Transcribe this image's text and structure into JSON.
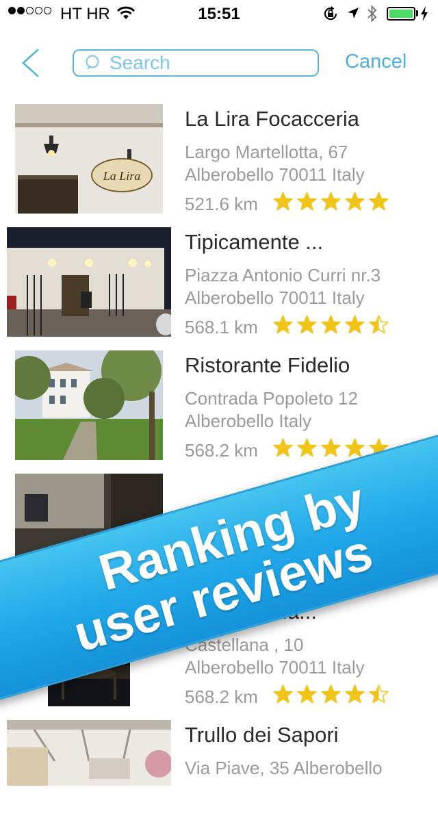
{
  "status_bar": {
    "carrier": "HT HR",
    "time": "15:51",
    "signal_bars_filled": 2,
    "signal_bars_total": 5,
    "battery_level": 1.0,
    "icons": [
      "wifi-icon",
      "rotation-lock-icon",
      "location-arrow-icon",
      "bluetooth-icon",
      "battery-icon",
      "charging-bolt-icon"
    ]
  },
  "nav": {
    "search_placeholder": "Search",
    "cancel_label": "Cancel"
  },
  "restaurants": [
    {
      "name": "La Lira Focacceria",
      "address_line1": "Largo Martellotta, 67",
      "address_line2": "Alberobello 70011 Italy",
      "distance": "521.6 km",
      "rating": 5
    },
    {
      "name": "Tipicamente ...",
      "address_line1": "Piazza Antonio Curri nr.3",
      "address_line2": "Alberobello 70011 Italy",
      "distance": "568.1 km",
      "rating": 4.5
    },
    {
      "name": "Ristorante Fidelio",
      "address_line1": "Contrada Popoleto 12",
      "address_line2": "Alberobello  Italy",
      "distance": "568.2 km",
      "rating": 5
    },
    {
      "name": "",
      "address_line1": "",
      "address_line2": "",
      "distance": "",
      "rating": 5
    },
    {
      "name": "...a Braceria...",
      "address_line1": "Castellana , 10",
      "address_line2": "Alberobello 70011 Italy",
      "distance": "568.2 km",
      "rating": 4.5
    },
    {
      "name": "Trullo dei Sapori",
      "address_line1": "Via Piave, 35 Alberobello",
      "address_line2": "",
      "distance": "",
      "rating": 0
    }
  ],
  "banner": {
    "line1": "Ranking by",
    "line2": "user reviews"
  },
  "colors": {
    "accent": "#4ab0db",
    "star": "#f0c419",
    "banner": "#1fa6e8",
    "battery": "#4cd964",
    "text_primary": "#2a2a2a",
    "text_secondary": "#9a9a9a"
  }
}
